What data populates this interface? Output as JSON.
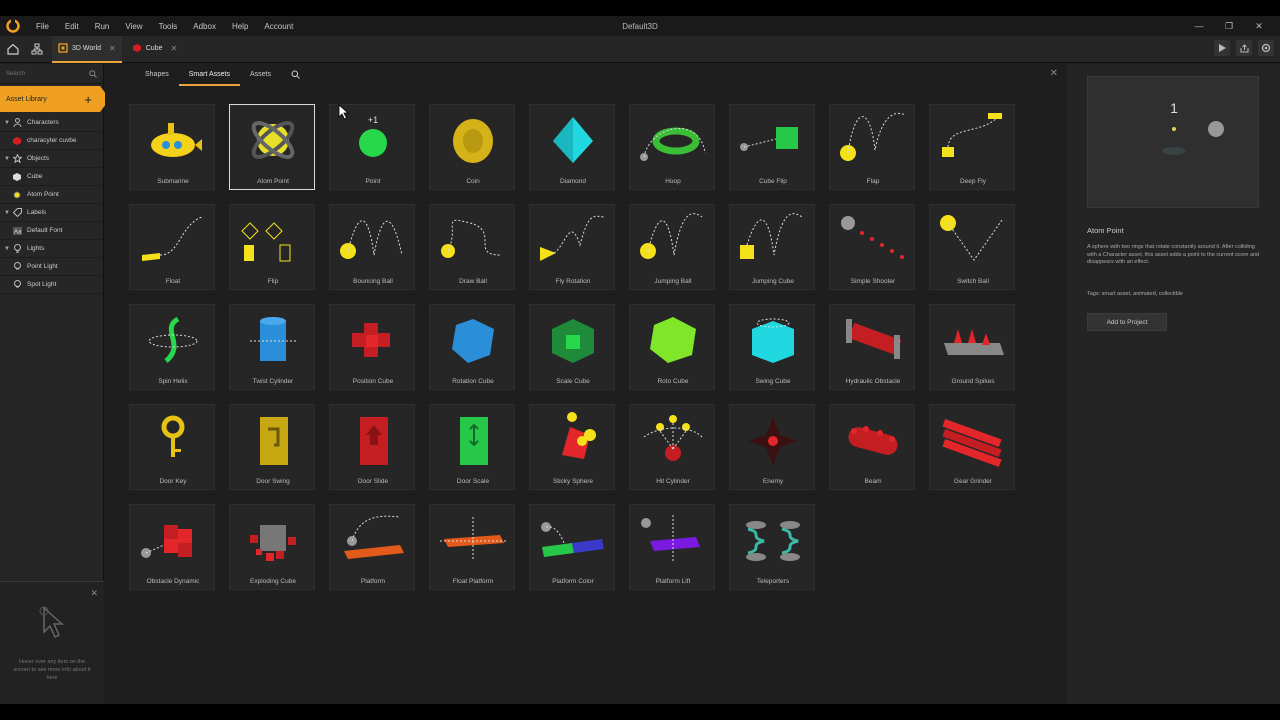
{
  "window": {
    "title": "Default3D"
  },
  "menu": [
    "File",
    "Edit",
    "Run",
    "View",
    "Tools",
    "Adbox",
    "Help",
    "Account"
  ],
  "doc_tabs": [
    {
      "label": "3D World",
      "active": true
    },
    {
      "label": "Cube",
      "active": false
    }
  ],
  "sidebar": {
    "search_placeholder": "Search",
    "asset_library_label": "Asset Library",
    "groups": [
      {
        "label": "Characters",
        "items": [
          "characyter cuvbe"
        ]
      },
      {
        "label": "Objects",
        "items": [
          "Cube",
          "Atom Point"
        ]
      },
      {
        "label": "Labels",
        "items": [
          "Default Font"
        ]
      },
      {
        "label": "Lights",
        "items": [
          "Point Light",
          "Spot Light"
        ]
      }
    ],
    "hint": "Hover over any item on the screen to see more info about it here"
  },
  "subtabs": [
    {
      "label": "Shapes",
      "active": false
    },
    {
      "label": "Smart Assets",
      "active": true
    },
    {
      "label": "Assets",
      "active": false
    }
  ],
  "assets": [
    "Submarine",
    "Atom Point",
    "Point",
    "Coin",
    "Diamond",
    "Hoop",
    "Cube Flip",
    "Flap",
    "Deep Fly",
    "Float",
    "Flip",
    "Bouncing Ball",
    "Draw Ball",
    "Fly Rotation",
    "Jumping Ball",
    "Jumping Cube",
    "Simple Shooter",
    "Switch Ball",
    "Spin Helix",
    "Twist Cylinder",
    "Position Cube",
    "Rotation Cube",
    "Scale Cube",
    "Roto Cube",
    "Swing Cube",
    "Hydraulic Obstacle",
    "Ground Spikes",
    "Door Key",
    "Door Swing",
    "Door Slide",
    "Door Scale",
    "Sticky Sphere",
    "Hit Cylinder",
    "Enemy",
    "Beam",
    "Gear Grinder",
    "Obstacle Dynamic",
    "Exploding Cube",
    "Platform",
    "Float Platform",
    "Platform Color",
    "Platform Lift",
    "Teleporters"
  ],
  "selected_asset": "Atom Point",
  "details": {
    "preview_number": "1",
    "title": "Atom Point",
    "description": "A sphere with two rings that rotate constantly around it. After colliding with a Character asset, this asset adds a point to the current score and disappears with an effect.",
    "tags": "Tags: smart asset, animated, collectible",
    "add_button": "Add to Project"
  },
  "colors": {
    "accent": "#f0a020",
    "yellow": "#f5e11a",
    "green": "#27d84a",
    "red": "#e3262a",
    "cyan": "#21d8e0",
    "blue": "#2a8fd8"
  }
}
